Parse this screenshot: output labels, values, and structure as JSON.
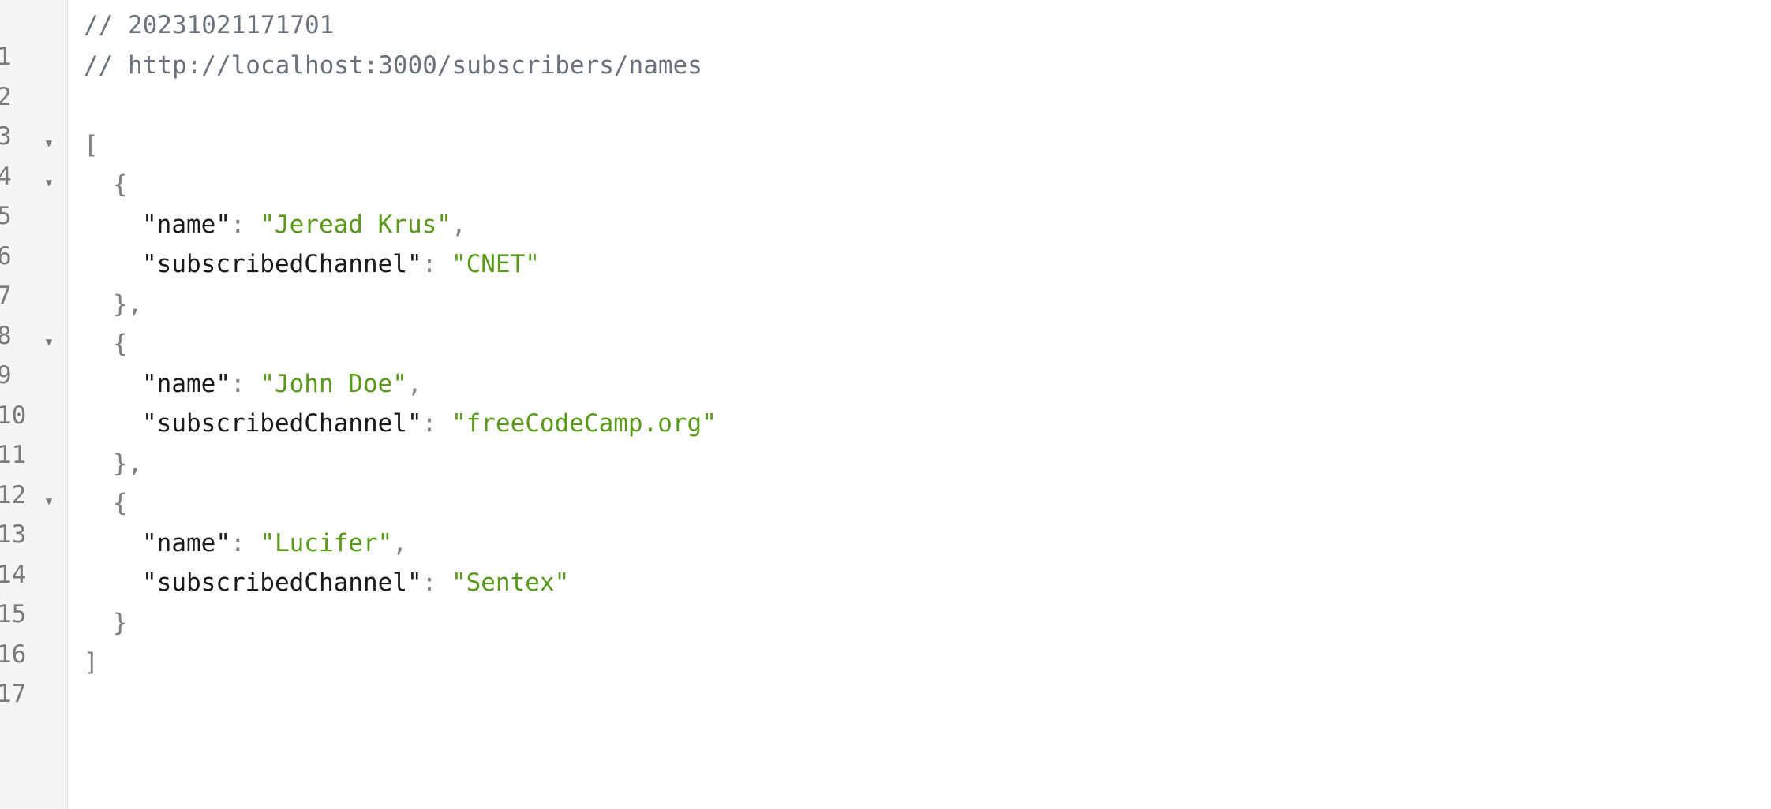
{
  "comment_timestamp": "// 20231021171701",
  "comment_url": "// http://localhost:3000/subscribers/names",
  "line_numbers": [
    "1",
    "2",
    "3",
    "4",
    "5",
    "6",
    "7",
    "8",
    "9",
    "10",
    "11",
    "12",
    "13",
    "14",
    "15",
    "16",
    "17"
  ],
  "fold_icon": "triangle-down",
  "punct": {
    "open_bracket": "[",
    "close_bracket": "]",
    "open_brace": "{",
    "close_brace_comma": "},",
    "close_brace": "}",
    "colon": ": ",
    "comma": ","
  },
  "records": [
    {
      "name_key": "\"name\"",
      "name": "\"Jeread Krus\"",
      "channel_key": "\"subscribedChannel\"",
      "channel": "\"CNET\""
    },
    {
      "name_key": "\"name\"",
      "name": "\"John Doe\"",
      "channel_key": "\"subscribedChannel\"",
      "channel": "\"freeCodeCamp.org\""
    },
    {
      "name_key": "\"name\"",
      "name": "\"Lucifer\"",
      "channel_key": "\"subscribedChannel\"",
      "channel": "\"Sentex\""
    }
  ]
}
